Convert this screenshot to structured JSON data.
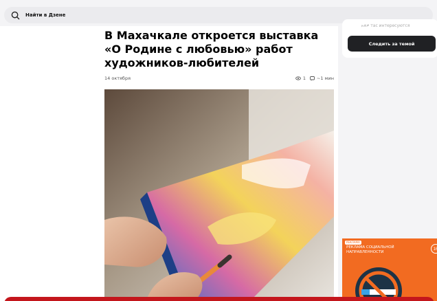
{
  "search": {
    "placeholder": "Найти в Дзене"
  },
  "article": {
    "title": "В Махачкале откроется выставка «О Родине с любовью» работ художников-любителей",
    "date": "14 октября",
    "views": "1",
    "read_time": "~1 мин"
  },
  "sidebar": {
    "faded_text": "አቂዎ тас интересуются",
    "follow_label": "Следить за темой"
  },
  "ad": {
    "tag": "РЕКЛАМА",
    "text": "РЕКЛАМА СОЦИАЛЬНОЙ НАПРАВЛЕННОСТИ",
    "close_label": "16"
  },
  "colors": {
    "accent_ad": "#f26b21",
    "button_dark": "#202124",
    "banner_red": "#c4161c"
  }
}
